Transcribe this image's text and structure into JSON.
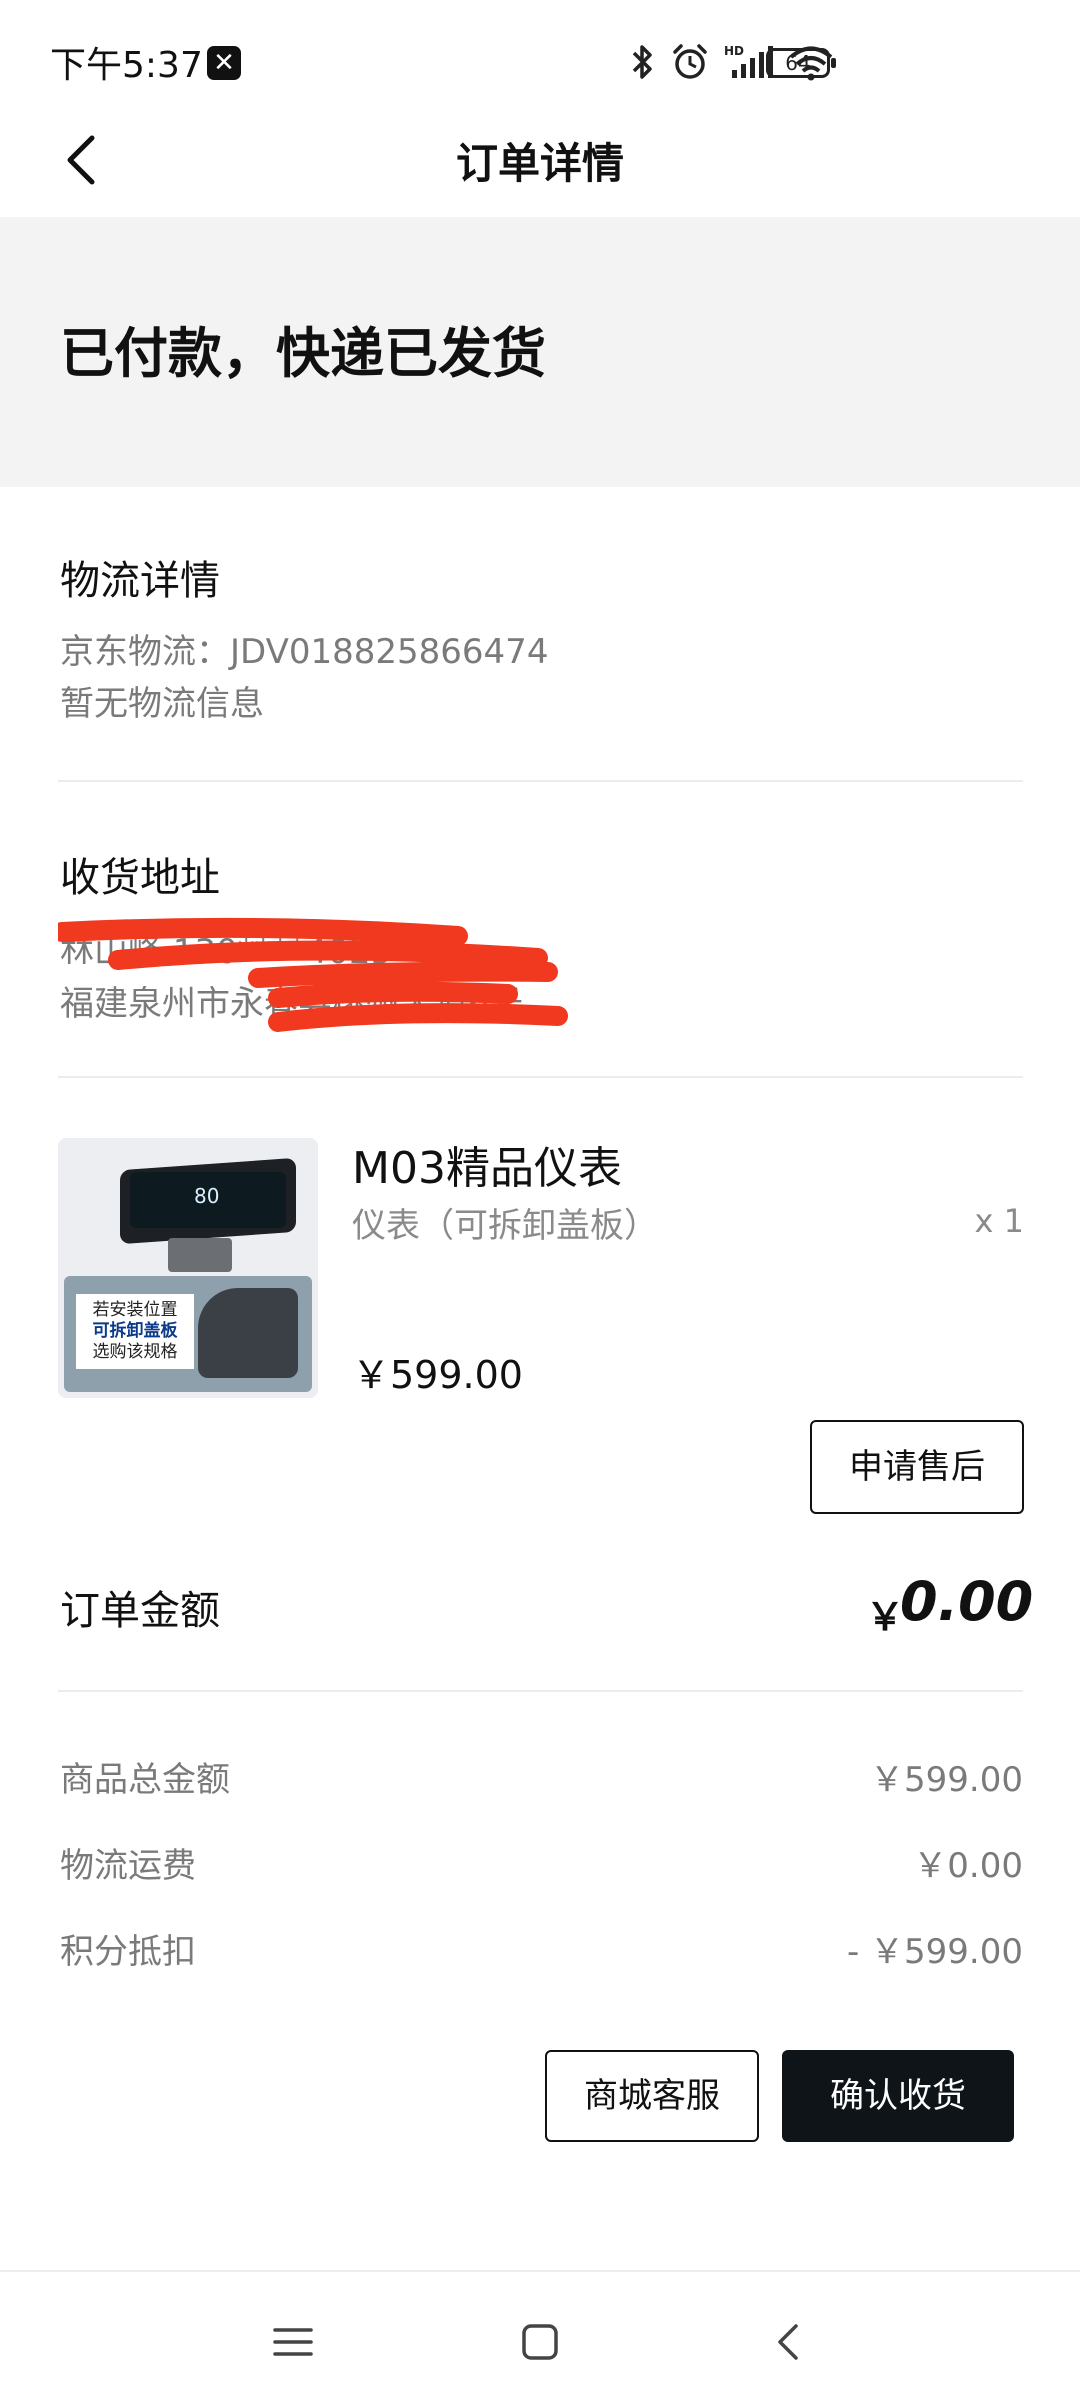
{
  "status_bar": {
    "time": "下午5:37",
    "notification_glyph": "✕",
    "battery": "64",
    "icons": [
      "bluetooth-icon",
      "alarm-icon",
      "signal-icon",
      "wifi-icon",
      "battery-icon"
    ]
  },
  "nav": {
    "title": "订单详情"
  },
  "order_status": "已付款，快递已发货",
  "logistics": {
    "title": "物流详情",
    "tracking": "京东物流：JDV018825866474",
    "info": "暂无物流信息"
  },
  "address": {
    "title": "收货地址",
    "line1": "林山峰  130****4025",
    "line2": "福建泉州市永春县桃州大道6号"
  },
  "product": {
    "name": "M03精品仪表",
    "spec": "仪表（可拆卸盖板）",
    "qty": "x 1",
    "price": "￥599.00",
    "image_caption_1": "若安装位置",
    "image_caption_2": "可拆卸盖板",
    "image_caption_3": "选购该规格",
    "image_speed": "80",
    "after_sale_label": "申请售后"
  },
  "order_amount": {
    "label": "订单金额",
    "currency": "￥",
    "value": "0.00"
  },
  "summary": [
    {
      "label": "商品总金额",
      "value": "￥599.00"
    },
    {
      "label": "物流运费",
      "value": "￥0.00"
    },
    {
      "label": "积分抵扣",
      "value": "- ￥599.00"
    }
  ],
  "actions": {
    "service_label": "商城客服",
    "confirm_label": "确认收货"
  },
  "colors": {
    "banner_bg": "#f3f3f3",
    "dark_button": "#0f1419",
    "redaction": "#f0391f",
    "muted_text": "#7a7a7a"
  }
}
